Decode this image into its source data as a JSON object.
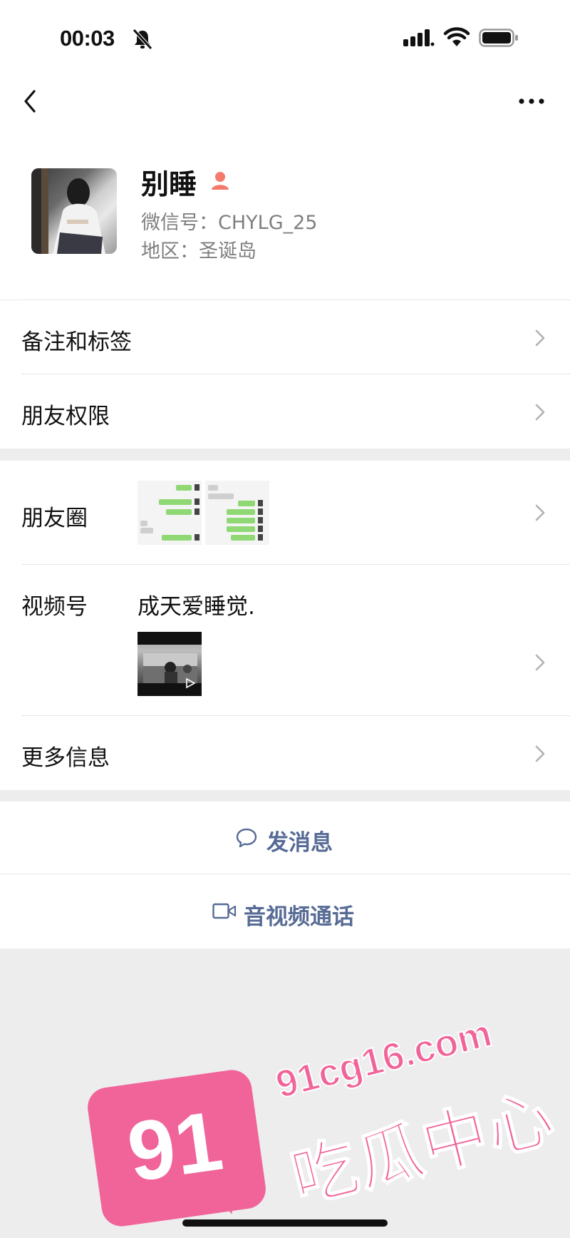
{
  "status_bar": {
    "time": "00:03",
    "icons": [
      "bell-off-icon",
      "signal-icon",
      "wifi-icon",
      "battery-icon"
    ]
  },
  "nav": {
    "icons": [
      "back-icon",
      "more-icon"
    ]
  },
  "profile": {
    "name": "别睡",
    "wechat_id": "微信号：CHYLG_25",
    "region": "地区：圣诞岛",
    "gender_icon_color": "#f47a6c"
  },
  "rows": {
    "remarks_tags": "备注和标签",
    "friend_permissions": "朋友权限",
    "moments": "朋友圈",
    "channels": "视频号",
    "channels_desc": "成天爱睡觉.",
    "more_info": "更多信息"
  },
  "actions": {
    "send_message": "发消息",
    "av_call": "音视频通话",
    "accent": "#576b95"
  },
  "watermark": {
    "number": "91",
    "url": "91cg16.com",
    "text": "吃瓜中心",
    "color": "#f0649a"
  }
}
